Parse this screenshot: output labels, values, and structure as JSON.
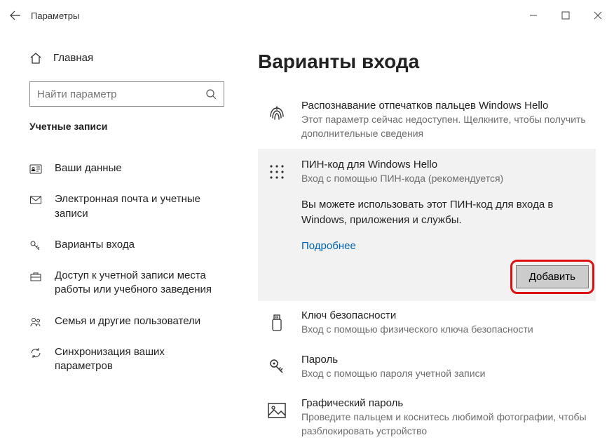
{
  "app_title": "Параметры",
  "search": {
    "placeholder": "Найти параметр"
  },
  "sidebar": {
    "home": "Главная",
    "section": "Учетные записи",
    "items": [
      {
        "label": "Ваши данные"
      },
      {
        "label": "Электронная почта и учетные записи"
      },
      {
        "label": "Варианты входа"
      },
      {
        "label": "Доступ к учетной записи места работы или учебного заведения"
      },
      {
        "label": "Семья и другие пользователи"
      },
      {
        "label": "Синхронизация ваших параметров"
      }
    ]
  },
  "page": {
    "title": "Варианты входа",
    "options": {
      "fingerprint": {
        "title": "Распознавание отпечатков пальцев Windows Hello",
        "sub": "Этот параметр сейчас недоступен. Щелкните, чтобы получить дополнительные сведения"
      },
      "pin": {
        "title": "ПИН-код для Windows Hello",
        "sub": "Вход с помощью ПИН-кода (рекомендуется)",
        "desc": "Вы можете использовать этот ПИН-код для входа в Windows, приложения и службы.",
        "learn_more": "Подробнее",
        "add": "Добавить"
      },
      "security_key": {
        "title": "Ключ безопасности",
        "sub": "Вход с помощью физического ключа безопасности"
      },
      "password": {
        "title": "Пароль",
        "sub": "Вход с помощью пароля учетной записи"
      },
      "picture_password": {
        "title": "Графический пароль",
        "sub": "Проведите пальцем и коснитесь любимой фотографии, чтобы разблокировать устройство"
      }
    }
  }
}
